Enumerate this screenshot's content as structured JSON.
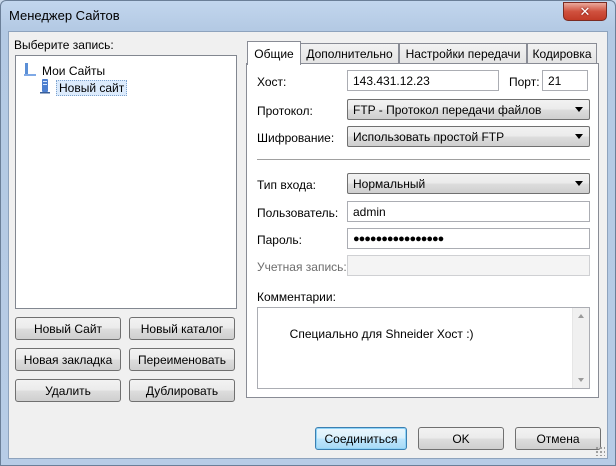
{
  "window": {
    "title": "Менеджер Сайтов",
    "close_glyph": "✕"
  },
  "left": {
    "select_label": "Выберите запись:",
    "tree": [
      {
        "label": "Мои Сайты",
        "icon": "folder-icon"
      },
      {
        "label": "Новый сайт",
        "icon": "server-icon"
      }
    ],
    "buttons": {
      "new_site": "Новый Сайт",
      "new_folder": "Новый каталог",
      "new_bookmark": "Новая закладка",
      "rename": "Переименовать",
      "delete": "Удалить",
      "duplicate": "Дублировать"
    }
  },
  "tabs": [
    {
      "label": "Общие",
      "active": true
    },
    {
      "label": "Дополнительно",
      "active": false
    },
    {
      "label": "Настройки передачи",
      "active": false
    },
    {
      "label": "Кодировка",
      "active": false
    }
  ],
  "general": {
    "host_label": "Хост:",
    "host_value": "143.431.12.23",
    "port_label": "Порт:",
    "port_value": "21",
    "protocol_label": "Протокол:",
    "protocol_value": "FTP - Протокол передачи файлов",
    "encryption_label": "Шифрование:",
    "encryption_value": "Использовать простой FTP",
    "logon_label": "Тип входа:",
    "logon_value": "Нормальный",
    "user_label": "Пользователь:",
    "user_value": "admin",
    "password_label": "Пароль:",
    "password_value": "●●●●●●●●●●●●●●●●",
    "account_label": "Учетная запись:",
    "account_value": "",
    "comments_label": "Комментарии:",
    "comments_value": "Специально для Shneider Хост :)"
  },
  "footer": {
    "connect": "Соединиться",
    "ok": "OK",
    "cancel": "Отмена"
  }
}
